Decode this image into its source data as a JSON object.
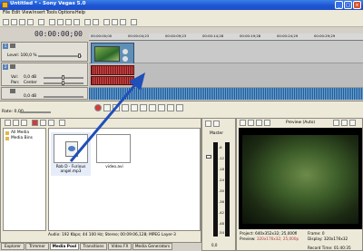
{
  "window": {
    "title": "Untitled * - Sony Vegas 5.0",
    "buttons": {
      "minimize": "_",
      "maximize": "□",
      "close": "×"
    }
  },
  "menu": [
    "File",
    "Edit",
    "View",
    "Insert",
    "Tools",
    "Options",
    "Help"
  ],
  "timeline": {
    "timecode": "00:00:00;00",
    "ruler": [
      "00:00:00;00",
      "00:00:04;23",
      "00:00:09;23",
      "00:00:14;28",
      "00:00:19;28",
      "00:00:24;29",
      "00:00:29;29"
    ],
    "video_track": {
      "number": "1",
      "level_label": "Level: 100,0 %"
    },
    "audio_track": {
      "number": "2",
      "vol_label": "Vol:",
      "vol_value": "0,0 dB",
      "pan_label": "Pan:",
      "pan_value": "Center"
    },
    "audio_track3": {
      "vol_value": "0,0 dB"
    }
  },
  "transport": {
    "rate": "Rate: 0,00"
  },
  "media_pool": {
    "tree": [
      "All Media",
      "Media Bins"
    ],
    "files": [
      {
        "name": "Rob D - Furious angel.mp3"
      },
      {
        "name": "video.avi"
      }
    ],
    "status": "Audio: 192 Kbps; 44 100 Hz; Stereo; 00:09:06,128; MPEG Layer-3"
  },
  "tabs": [
    "Explorer",
    "Trimmer",
    "Media Pool",
    "Transitions",
    "Video FX",
    "Media Generators"
  ],
  "active_tab": "Media Pool",
  "master": {
    "label": "Master",
    "scale": [
      "-6",
      "-12",
      "-18",
      "-24",
      "-30",
      "-36",
      "-42",
      "-48",
      "-54"
    ],
    "db": "0,0"
  },
  "preview": {
    "mode": "Preview (Auto)",
    "project_label": "Project:",
    "project_value": "640x352x32; 25,000fi",
    "preview_label": "Preview:",
    "preview_value": "320x176x32; 25,000p",
    "frame_label": "Frame:",
    "frame_value": "0",
    "display_label": "Display:",
    "display_value": "320x176x32",
    "record_label": "Record Time:",
    "record_value": "01:40:35"
  },
  "colors": {
    "titlebar": "#1d55d4",
    "arrow": "#1f4fb8",
    "accent_red": "#b23a3a"
  }
}
